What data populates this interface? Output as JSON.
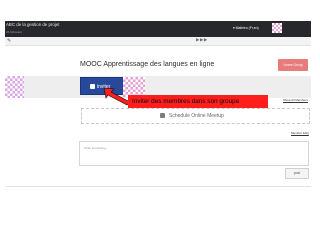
{
  "topbar": {
    "title": "ABC de la gestion de projet",
    "subtitle": "26 followers",
    "user": "▾ Mathieu (Fr,en)"
  },
  "toolbar": {
    "nav": "▶▶▶",
    "icons": [
      "wrench-icon"
    ]
  },
  "group": {
    "title": "MOOC Apprentissage des langues en ligne",
    "leave_label": "Leave Group"
  },
  "invite": {
    "label": "inviter"
  },
  "callout": {
    "text": "Inviter des membres dans son groupe"
  },
  "members": {
    "show_all": "Show All Members"
  },
  "meetup": {
    "label": "Schedule Online Meetup"
  },
  "faq": {
    "label": "Member FAQ"
  },
  "comment": {
    "placeholder": "Write something...",
    "post_label": "post"
  },
  "colors": {
    "topbar": "#26282c",
    "leave_button": "#e67c7c",
    "invite_button": "#27489b",
    "callout": "#ff1e1e"
  }
}
